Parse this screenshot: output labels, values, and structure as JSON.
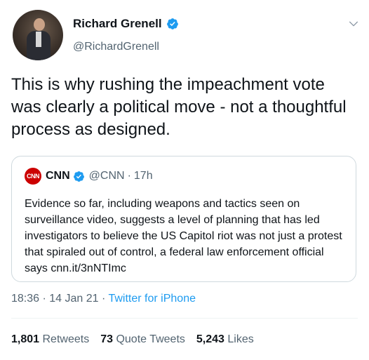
{
  "author": {
    "name": "Richard Grenell",
    "handle": "@RichardGrenell"
  },
  "tweet_text": "This is why rushing the impeachment vote was clearly a political move - not a thoughtful process as designed.",
  "quote": {
    "logo_text": "CNN",
    "name": "CNN",
    "handle": "@CNN",
    "separator": "·",
    "time": "17h",
    "text": "Evidence so far, including weapons and tactics seen on surveillance video, suggests a level of planning that has led investigators to believe the US Capitol riot was not just a protest that spiraled out of control, a federal law enforcement official says cnn.it/3nNTImc"
  },
  "meta": {
    "time": "18:36",
    "sep1": " · ",
    "date": "14 Jan 21",
    "sep2": " · ",
    "source": "Twitter for iPhone"
  },
  "stats": {
    "retweets_count": "1,801",
    "retweets_label": "Retweets",
    "quotes_count": "73",
    "quotes_label": "Quote Tweets",
    "likes_count": "5,243",
    "likes_label": "Likes"
  },
  "colors": {
    "accent": "#1d9bf0",
    "secondary_text": "#536471",
    "cnn_red": "#cc0000"
  },
  "icons": {
    "verified": "verified-badge-icon",
    "more": "chevron-down-icon"
  }
}
